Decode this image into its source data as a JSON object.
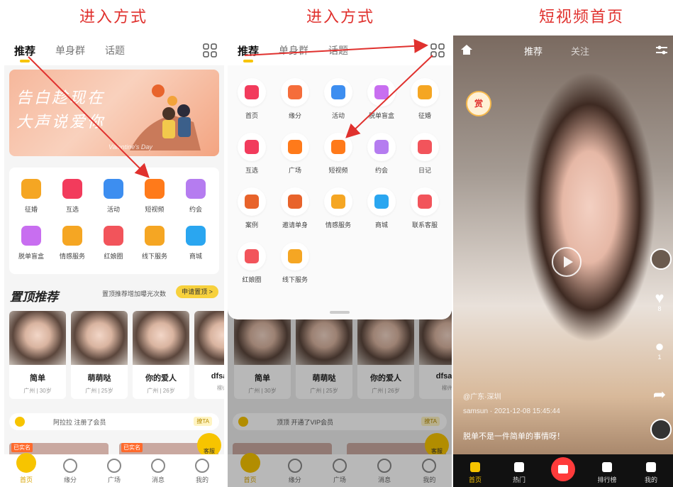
{
  "captions": [
    "进入方式",
    "进入方式",
    "短视频首页"
  ],
  "panel1": {
    "tabs": [
      "推荐",
      "单身群",
      "话题"
    ],
    "banner": {
      "line1": "告白趁现在",
      "line2": "大声说爱你",
      "sub": "Valentine's Day"
    },
    "icons": [
      {
        "label": "征婚",
        "color": "#f5a623",
        "icon": "briefcase-icon"
      },
      {
        "label": "互选",
        "color": "#f23b5c",
        "icon": "heart-icon"
      },
      {
        "label": "活动",
        "color": "#3d8ef0",
        "icon": "balloon-icon"
      },
      {
        "label": "短视频",
        "color": "#ff7a1a",
        "icon": "video-icon"
      },
      {
        "label": "约会",
        "color": "#b57cf0",
        "icon": "cheers-icon"
      },
      {
        "label": "脱单盲盒",
        "color": "#c86ef0",
        "icon": "box-icon"
      },
      {
        "label": "情感服务",
        "color": "#f5a623",
        "icon": "counselor-icon"
      },
      {
        "label": "红娘圈",
        "color": "#f2545b",
        "icon": "matchmaker-icon"
      },
      {
        "label": "线下服务",
        "color": "#f5a623",
        "icon": "store-icon"
      },
      {
        "label": "商城",
        "color": "#2aa6f0",
        "icon": "shop-icon"
      }
    ],
    "section": {
      "title": "置顶推荐",
      "tip": "置顶推荐增加曝光次数",
      "button": "申请置顶 >"
    },
    "profiles": [
      {
        "name": "简单",
        "meta": "广州 | 30岁"
      },
      {
        "name": "萌萌哒",
        "meta": "广州 | 25岁"
      },
      {
        "name": "你的爱人",
        "meta": "广州 | 26岁"
      },
      {
        "name": "dfsafs",
        "meta": "柳州"
      }
    ],
    "notice": {
      "text": "阿拉拉 注册了会员",
      "badge": "撩TA"
    },
    "tags": [
      "已实名",
      "已实名"
    ],
    "service": "客服",
    "nav": [
      "首页",
      "缘分",
      "广场",
      "消息",
      "我的"
    ]
  },
  "panel2": {
    "tabs": [
      "推荐",
      "单身群",
      "话题"
    ],
    "menu": [
      {
        "label": "首页",
        "color": "#f23b5c",
        "icon": "home-icon"
      },
      {
        "label": "缘分",
        "color": "#f56d3b",
        "icon": "heart-icon"
      },
      {
        "label": "活动",
        "color": "#3d8ef0",
        "icon": "balloon-icon"
      },
      {
        "label": "脱单盲盒",
        "color": "#c86ef0",
        "icon": "box-icon"
      },
      {
        "label": "征婚",
        "color": "#f5a623",
        "icon": "briefcase-icon"
      },
      {
        "label": "互选",
        "color": "#f23b5c",
        "icon": "heart-icon"
      },
      {
        "label": "广场",
        "color": "#ff7a1a",
        "icon": "compass-icon"
      },
      {
        "label": "短视频",
        "color": "#ff7a1a",
        "icon": "video-icon"
      },
      {
        "label": "约会",
        "color": "#b57cf0",
        "icon": "cheers-icon"
      },
      {
        "label": "日记",
        "color": "#f2545b",
        "icon": "diary-icon"
      },
      {
        "label": "案例",
        "color": "#e8632b",
        "icon": "books-icon"
      },
      {
        "label": "邀请单身",
        "color": "#e8632b",
        "icon": "invite-icon"
      },
      {
        "label": "情感服务",
        "color": "#f5a623",
        "icon": "counselor-icon"
      },
      {
        "label": "商城",
        "color": "#2aa6f0",
        "icon": "shop-icon"
      },
      {
        "label": "联系客服",
        "color": "#f2545b",
        "icon": "headset-icon"
      },
      {
        "label": "红娘圈",
        "color": "#f2545b",
        "icon": "matchmaker-icon"
      },
      {
        "label": "线下服务",
        "color": "#f5a623",
        "icon": "store-icon"
      }
    ],
    "profiles": [
      {
        "name": "简单",
        "meta": "广州 | 30岁"
      },
      {
        "name": "萌萌哒",
        "meta": "广州 | 25岁"
      },
      {
        "name": "你的爱人",
        "meta": "广州 | 26岁"
      },
      {
        "name": "dfsafs",
        "meta": "柳州"
      }
    ],
    "notice": {
      "text": "顶顶 开通了VIP会员",
      "badge": "撩TA"
    },
    "service": "客服",
    "nav": [
      "首页",
      "缘分",
      "广场",
      "消息",
      "我的"
    ]
  },
  "panel3": {
    "tabs": [
      "推荐",
      "关注"
    ],
    "red_packet": "赏",
    "like_count": "8",
    "comment_count": "1",
    "location": "@广东·深圳",
    "author_line": "samsun · 2021-12-08 15:45:44",
    "caption": "脱单不是一件简单的事情呀！",
    "nav": [
      "首页",
      "热门",
      "",
      "排行榜",
      "我的"
    ]
  }
}
